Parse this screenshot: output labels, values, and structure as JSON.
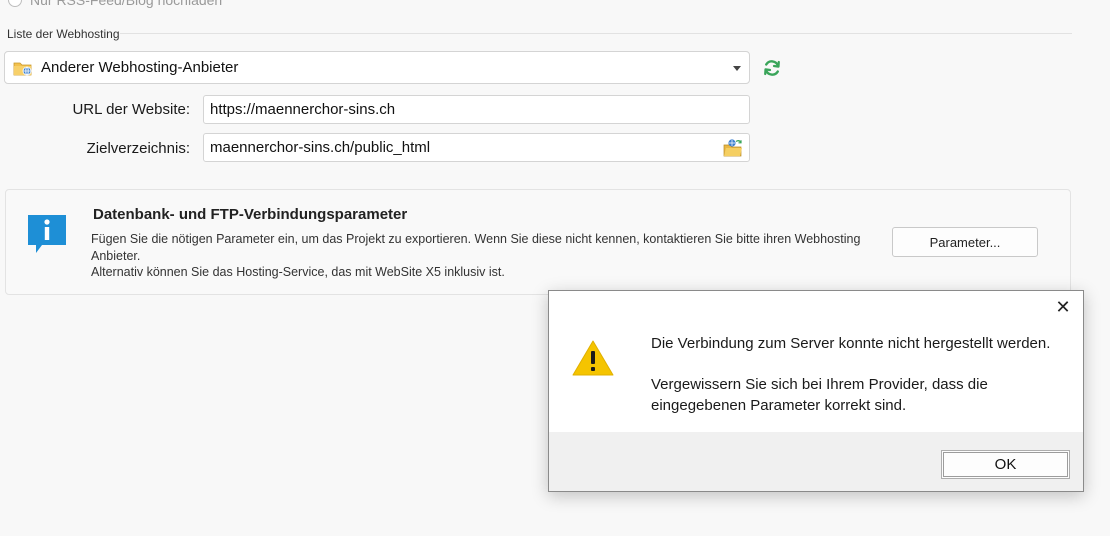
{
  "top_radio": {
    "label": "Nur RSS-Feed/Blog hochladen"
  },
  "hosting_section": {
    "label": "Liste der Webhosting",
    "provider_select": {
      "value": "Anderer Webhosting-Anbieter",
      "icon": "web-folder-icon"
    },
    "refresh_icon": "refresh-icon"
  },
  "form": {
    "url_label": "URL der Website:",
    "url_value": "https://maennerchor-sins.ch",
    "dir_label": "Zielverzeichnis:",
    "dir_value": "maennerchor-sins.ch/public_html",
    "browse_icon": "browse-folder-icon"
  },
  "info_box": {
    "title": "Datenbank- und FTP-Verbindungsparameter",
    "line1": "Fügen Sie die nötigen Parameter ein, um das Projekt zu exportieren. Wenn Sie diese nicht kennen, kontaktieren Sie bitte ihren Webhosting Anbieter.",
    "line2": "Alternativ können Sie das Hosting-Service, das mit WebSite X5 inklusiv ist.",
    "button_label": "Parameter..."
  },
  "dialog": {
    "close_glyph": "✕",
    "message1": "Die Verbindung zum Server konnte nicht hergestellt werden.",
    "message2": "Vergewissern Sie sich bei Ihrem Provider, dass die eingegebenen Parameter korrekt sind.",
    "ok_label": "OK"
  },
  "colors": {
    "warning": "#f5c400",
    "info_blue": "#1e8fd6",
    "refresh_green": "#3aa55a"
  }
}
